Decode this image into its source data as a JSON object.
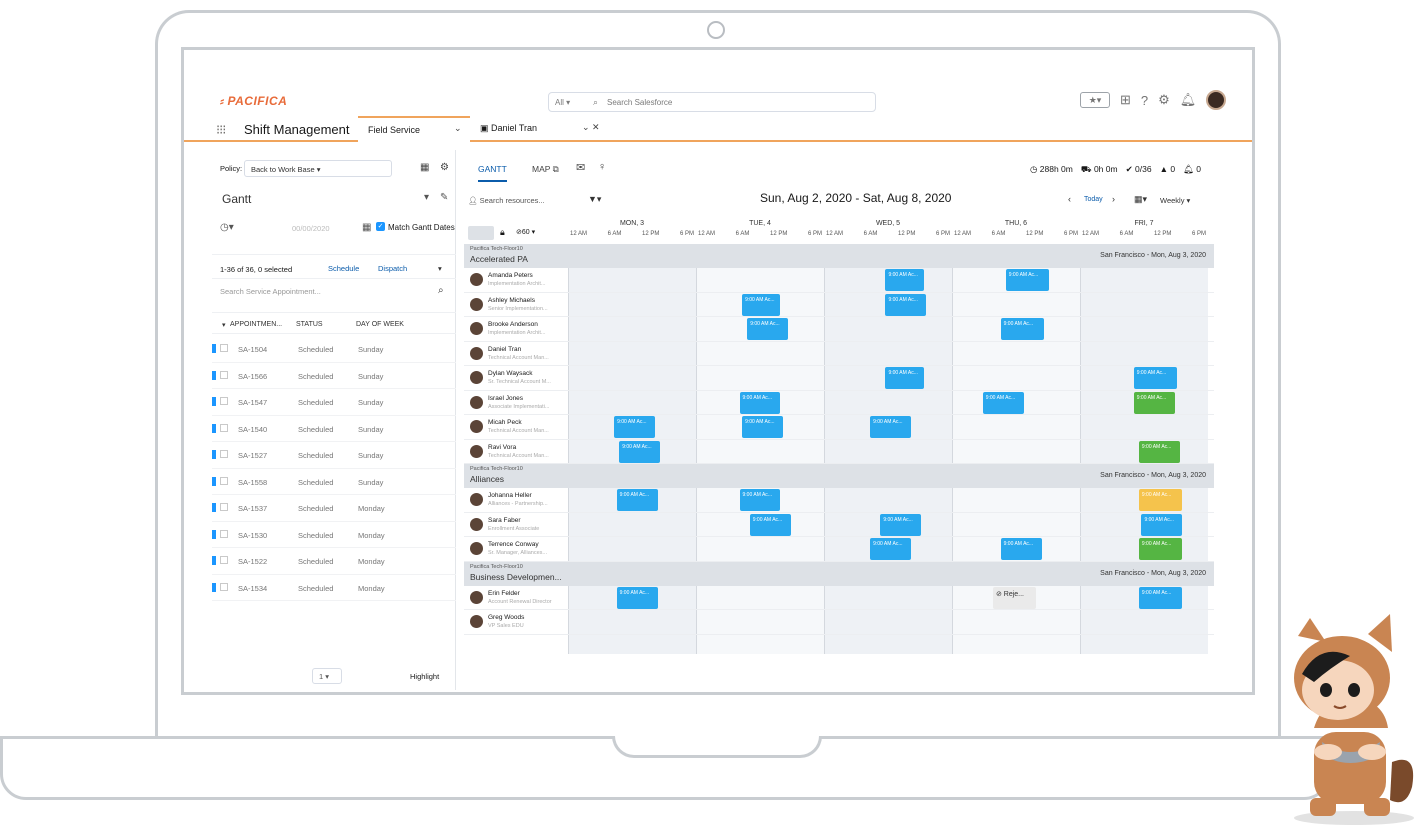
{
  "header": {
    "logo_text": "PACIFICA",
    "search_scope": "All",
    "search_placeholder": "Search Salesforce"
  },
  "app_bar": {
    "app_name": "Shift Management",
    "tab_primary": "Field Service",
    "tab_secondary": "Daniel Tran"
  },
  "left_panel": {
    "policy_label": "Policy:",
    "policy_value": "Back to Work Base",
    "view_name": "Gantt",
    "date_value": "00/00/2020",
    "match_label": "Match Gantt Dates",
    "selection_count": "1-36 of 36, 0 selected",
    "schedule_button": "Schedule",
    "dispatch_button": "Dispatch",
    "search_placeholder": "Search Service Appointment...",
    "columns": [
      "APPOINTMEN...",
      "STATUS",
      "DAY OF WEEK"
    ],
    "appointments": [
      {
        "id": "SA-1504",
        "status": "Scheduled",
        "day": "Sunday"
      },
      {
        "id": "SA-1566",
        "status": "Scheduled",
        "day": "Sunday"
      },
      {
        "id": "SA-1547",
        "status": "Scheduled",
        "day": "Sunday"
      },
      {
        "id": "SA-1540",
        "status": "Scheduled",
        "day": "Sunday"
      },
      {
        "id": "SA-1527",
        "status": "Scheduled",
        "day": "Sunday"
      },
      {
        "id": "SA-1558",
        "status": "Scheduled",
        "day": "Sunday"
      },
      {
        "id": "SA-1537",
        "status": "Scheduled",
        "day": "Monday"
      },
      {
        "id": "SA-1530",
        "status": "Scheduled",
        "day": "Monday"
      },
      {
        "id": "SA-1522",
        "status": "Scheduled",
        "day": "Monday"
      },
      {
        "id": "SA-1534",
        "status": "Scheduled",
        "day": "Monday"
      }
    ],
    "page": "1",
    "highlight_label": "Highlight"
  },
  "gantt": {
    "tab_gantt": "GANTT",
    "tab_map": "MAP",
    "kpi_hours": "288h 0m",
    "kpi_travel": "0h 0m",
    "kpi_count": "0/36",
    "kpi_warn": "0",
    "kpi_alert": "0",
    "search_resources": "Search resources...",
    "date_range": "Sun, Aug 2, 2020 - Sat, Aug 8, 2020",
    "today_label": "Today",
    "view_mode": "Weekly",
    "zoom_value": "60",
    "days": [
      "MON, 3",
      "TUE, 4",
      "WED, 5",
      "THU, 6",
      "FRI, 7"
    ],
    "hours": [
      "12 AM",
      "6 AM",
      "12 PM",
      "6 PM"
    ],
    "groups": [
      {
        "org": "Pacifica Tech-Floor10",
        "name": "Accelerated PA",
        "location": "San Francisco - Mon, Aug 3, 2020",
        "resources": [
          {
            "name": "Amanda Peters",
            "role": "Implementation Archit..."
          },
          {
            "name": "Ashley Michaels",
            "role": "Senior Implementation..."
          },
          {
            "name": "Brooke Anderson",
            "role": "Implementation Archit..."
          },
          {
            "name": "Daniel Tran",
            "role": "Technical Account Man..."
          },
          {
            "name": "Dylan Waysack",
            "role": "Sr. Technical Account M..."
          },
          {
            "name": "Israel Jones",
            "role": "Associate Implementati..."
          },
          {
            "name": "Micah Peck",
            "role": "Technical Account Man..."
          },
          {
            "name": "Ravi Vora",
            "role": "Technical Account Man..."
          }
        ]
      },
      {
        "org": "Pacifica Tech-Floor10",
        "name": "Alliances",
        "location": "San Francisco - Mon, Aug 3, 2020",
        "resources": [
          {
            "name": "Johanna Heller",
            "role": "Alliances - Partnership..."
          },
          {
            "name": "Sara Faber",
            "role": "Enrollment Associate"
          },
          {
            "name": "Terrence Conway",
            "role": "Sr. Manager, Alliances..."
          }
        ]
      },
      {
        "org": "Pacifica Tech-Floor10",
        "name": "Business Developmen...",
        "location": "San Francisco - Mon, Aug 3, 2020",
        "resources": [
          {
            "name": "Erin Felder",
            "role": "Account Renewal Director"
          },
          {
            "name": "Greg Woods",
            "role": "VP Sales EDU"
          }
        ]
      }
    ],
    "block_labels": {
      "am9": "9:00 AM Ac...",
      "rejected": "Reje..."
    }
  },
  "colors": {
    "brand_orange": "#e86b3a",
    "appointment_blue": "#29a8ee",
    "appointment_green": "#55b543",
    "appointment_yellow": "#f5c34c"
  }
}
